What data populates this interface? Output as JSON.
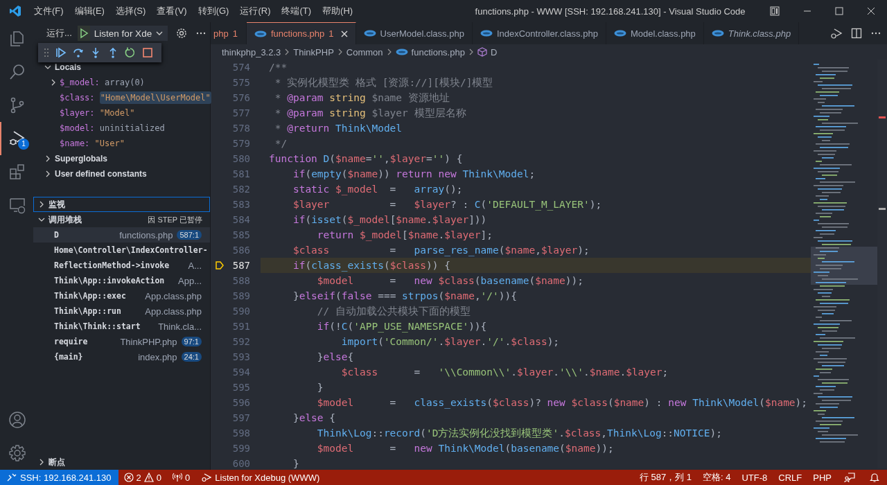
{
  "title_bar": {
    "menus": [
      "文件(F)",
      "编辑(E)",
      "选择(S)",
      "查看(V)",
      "转到(G)",
      "运行(R)",
      "终端(T)",
      "帮助(H)"
    ],
    "title": "functions.php - WWW [SSH: 192.168.241.130] - Visual Studio Code"
  },
  "activity_bar": {
    "items": [
      {
        "kind": "explorer",
        "selected": false
      },
      {
        "kind": "search",
        "selected": false
      },
      {
        "kind": "scm",
        "selected": false
      },
      {
        "kind": "debug",
        "selected": true,
        "badge": "1"
      },
      {
        "kind": "extensions",
        "selected": false
      },
      {
        "kind": "remote",
        "selected": false
      }
    ],
    "bottom": [
      {
        "kind": "account"
      },
      {
        "kind": "settings"
      }
    ]
  },
  "run_view": {
    "title": "运行...",
    "config": "Listen for Xde",
    "debug_toolbar": [
      {
        "kind": "continue"
      },
      {
        "kind": "step_over"
      },
      {
        "kind": "step_into"
      },
      {
        "kind": "step_out"
      },
      {
        "kind": "restart"
      },
      {
        "kind": "stop"
      }
    ],
    "locals": {
      "label": "Locals",
      "expanded": true,
      "variables": [
        {
          "name": "$_model:",
          "value": "array(0)",
          "kind": "other",
          "expandable": true,
          "selected": false
        },
        {
          "name": "$class:",
          "value": "\"Home\\Model\\UserModel\"",
          "kind": "string",
          "expandable": false,
          "selected": true
        },
        {
          "name": "$layer:",
          "value": "\"Model\"",
          "kind": "string",
          "expandable": false,
          "selected": false
        },
        {
          "name": "$model:",
          "value": "uninitialized",
          "kind": "other",
          "expandable": false,
          "selected": false
        },
        {
          "name": "$name:",
          "value": "\"User\"",
          "kind": "string",
          "expandable": false,
          "selected": false
        }
      ]
    },
    "groups": [
      {
        "label": "Superglobals",
        "expanded": false
      },
      {
        "label": "User defined constants",
        "expanded": false
      }
    ],
    "watch": {
      "label": "监视",
      "expanded": false,
      "focused": true
    },
    "call_stack": {
      "label": "调用堆栈",
      "expanded": true,
      "status": "因 STEP 已暂停",
      "frames": [
        {
          "name": "D",
          "file": "functions.php",
          "line": "587:1",
          "selected": true
        },
        {
          "name": "Home\\Controller\\IndexController-",
          "selected": false
        },
        {
          "name": "ReflectionMethod->invoke",
          "file": "A...",
          "selected": false
        },
        {
          "name": "Think\\App::invokeAction",
          "file": "App...",
          "selected": false
        },
        {
          "name": "Think\\App::exec",
          "file": "App.class.php",
          "selected": false
        },
        {
          "name": "Think\\App::run",
          "file": "App.class.php",
          "selected": false
        },
        {
          "name": "Think\\Think::start",
          "file": "Think.cla...",
          "selected": false
        },
        {
          "name": "require",
          "file": "ThinkPHP.php",
          "line": "97:1",
          "selected": false
        },
        {
          "name": "{main}",
          "file": "index.php",
          "line": "24:1",
          "selected": false
        }
      ]
    },
    "breakpoints": {
      "label": "断点",
      "expanded": false
    }
  },
  "tabs": [
    {
      "label": "php",
      "problems": "1",
      "selected": false,
      "cut": true,
      "preview": false
    },
    {
      "label": "functions.php",
      "problems": "1",
      "selected": true,
      "cut": false,
      "preview": false
    },
    {
      "label": "UserModel.class.php",
      "selected": false,
      "cut": false,
      "preview": false
    },
    {
      "label": "IndexController.class.php",
      "selected": false,
      "cut": false,
      "preview": false
    },
    {
      "label": "Model.class.php",
      "selected": false,
      "cut": false,
      "preview": false
    },
    {
      "label": "Think.class.php",
      "selected": false,
      "cut": false,
      "preview": true
    }
  ],
  "breadcrumb": [
    {
      "label": "thinkphp_3.2.3",
      "kind": "folder"
    },
    {
      "label": "ThinkPHP",
      "kind": "folder"
    },
    {
      "label": "Common",
      "kind": "folder"
    },
    {
      "label": "functions.php",
      "kind": "file"
    },
    {
      "label": "D",
      "kind": "symbol"
    }
  ],
  "editor": {
    "lines": [
      {
        "n": "574",
        "paused": false,
        "tokens": [
          {
            "kind": "comment",
            "text": "/**"
          }
        ]
      },
      {
        "n": "575",
        "paused": false,
        "tokens": [
          {
            "kind": "comment",
            "text": " * 实例化模型类 格式 [资源://][模块/]模型"
          }
        ]
      },
      {
        "n": "576",
        "paused": false,
        "tokens": [
          {
            "kind": "comment",
            "text": " * "
          },
          {
            "kind": "doctag",
            "text": "@param"
          },
          {
            "kind": "doctype",
            "text": " string"
          },
          {
            "kind": "comment",
            "text": " $name 资源地址"
          }
        ]
      },
      {
        "n": "577",
        "paused": false,
        "tokens": [
          {
            "kind": "comment",
            "text": " * "
          },
          {
            "kind": "doctag",
            "text": "@param"
          },
          {
            "kind": "doctype",
            "text": " string"
          },
          {
            "kind": "comment",
            "text": " $layer 模型层名称"
          }
        ]
      },
      {
        "n": "578",
        "paused": false,
        "tokens": [
          {
            "kind": "comment",
            "text": " * "
          },
          {
            "kind": "doctag",
            "text": "@return"
          },
          {
            "kind": "type",
            "text": " Think\\Model"
          }
        ]
      },
      {
        "n": "579",
        "paused": false,
        "tokens": [
          {
            "kind": "comment",
            "text": " */"
          }
        ]
      },
      {
        "n": "580",
        "paused": false,
        "tokens": [
          {
            "kind": "keyword",
            "text": "function"
          },
          {
            "kind": "function",
            "text": " D"
          },
          {
            "kind": "plain",
            "text": "("
          },
          {
            "kind": "variable",
            "text": "$name"
          },
          {
            "kind": "plain",
            "text": "="
          },
          {
            "kind": "string",
            "text": "''"
          },
          {
            "kind": "plain",
            "text": ","
          },
          {
            "kind": "variable",
            "text": "$layer"
          },
          {
            "kind": "plain",
            "text": "="
          },
          {
            "kind": "string",
            "text": "''"
          },
          {
            "kind": "plain",
            "text": ") {"
          }
        ]
      },
      {
        "n": "581",
        "paused": false,
        "tokens": [
          {
            "kind": "keyword",
            "text": "    if"
          },
          {
            "kind": "plain",
            "text": "("
          },
          {
            "kind": "function",
            "text": "empty"
          },
          {
            "kind": "plain",
            "text": "("
          },
          {
            "kind": "variable",
            "text": "$name"
          },
          {
            "kind": "plain",
            "text": "))"
          },
          {
            "kind": "keyword",
            "text": " return new"
          },
          {
            "kind": "type",
            "text": " Think\\Model"
          },
          {
            "kind": "plain",
            "text": ";"
          }
        ]
      },
      {
        "n": "582",
        "paused": false,
        "tokens": [
          {
            "kind": "keyword",
            "text": "    static"
          },
          {
            "kind": "variable",
            "text": " $_model"
          },
          {
            "kind": "plain",
            "text": "  =   "
          },
          {
            "kind": "function",
            "text": "array"
          },
          {
            "kind": "plain",
            "text": "();"
          }
        ]
      },
      {
        "n": "583",
        "paused": false,
        "tokens": [
          {
            "kind": "variable",
            "text": "    $layer"
          },
          {
            "kind": "plain",
            "text": "          =   "
          },
          {
            "kind": "variable",
            "text": "$layer"
          },
          {
            "kind": "plain",
            "text": "? : "
          },
          {
            "kind": "function",
            "text": "C"
          },
          {
            "kind": "plain",
            "text": "("
          },
          {
            "kind": "string",
            "text": "'DEFAULT_M_LAYER'"
          },
          {
            "kind": "plain",
            "text": ");"
          }
        ]
      },
      {
        "n": "584",
        "paused": false,
        "tokens": [
          {
            "kind": "keyword",
            "text": "    if"
          },
          {
            "kind": "plain",
            "text": "("
          },
          {
            "kind": "function",
            "text": "isset"
          },
          {
            "kind": "plain",
            "text": "("
          },
          {
            "kind": "variable",
            "text": "$_model"
          },
          {
            "kind": "plain",
            "text": "["
          },
          {
            "kind": "variable",
            "text": "$name"
          },
          {
            "kind": "plain",
            "text": "."
          },
          {
            "kind": "variable",
            "text": "$layer"
          },
          {
            "kind": "plain",
            "text": "]))"
          }
        ]
      },
      {
        "n": "585",
        "paused": false,
        "tokens": [
          {
            "kind": "keyword",
            "text": "        return"
          },
          {
            "kind": "variable",
            "text": " $_model"
          },
          {
            "kind": "plain",
            "text": "["
          },
          {
            "kind": "variable",
            "text": "$name"
          },
          {
            "kind": "plain",
            "text": "."
          },
          {
            "kind": "variable",
            "text": "$layer"
          },
          {
            "kind": "plain",
            "text": "];"
          }
        ]
      },
      {
        "n": "586",
        "paused": false,
        "tokens": [
          {
            "kind": "variable",
            "text": "    $class"
          },
          {
            "kind": "plain",
            "text": "          =   "
          },
          {
            "kind": "function",
            "text": "parse_res_name"
          },
          {
            "kind": "plain",
            "text": "("
          },
          {
            "kind": "variable",
            "text": "$name"
          },
          {
            "kind": "plain",
            "text": ","
          },
          {
            "kind": "variable",
            "text": "$layer"
          },
          {
            "kind": "plain",
            "text": ");"
          }
        ]
      },
      {
        "n": "587",
        "paused": true,
        "tokens": [
          {
            "kind": "keyword",
            "text": "    if"
          },
          {
            "kind": "plain",
            "text": "("
          },
          {
            "kind": "function",
            "text": "class_exists"
          },
          {
            "kind": "plain",
            "text": "("
          },
          {
            "kind": "variable",
            "text": "$class"
          },
          {
            "kind": "plain",
            "text": ")) {"
          }
        ]
      },
      {
        "n": "588",
        "paused": false,
        "tokens": [
          {
            "kind": "variable",
            "text": "        $model"
          },
          {
            "kind": "plain",
            "text": "      =   "
          },
          {
            "kind": "keyword",
            "text": "new"
          },
          {
            "kind": "variable",
            "text": " $class"
          },
          {
            "kind": "plain",
            "text": "("
          },
          {
            "kind": "function",
            "text": "basename"
          },
          {
            "kind": "plain",
            "text": "("
          },
          {
            "kind": "variable",
            "text": "$name"
          },
          {
            "kind": "plain",
            "text": "));"
          }
        ]
      },
      {
        "n": "589",
        "paused": false,
        "tokens": [
          {
            "kind": "plain",
            "text": "    }"
          },
          {
            "kind": "keyword",
            "text": "elseif"
          },
          {
            "kind": "plain",
            "text": "("
          },
          {
            "kind": "keyword",
            "text": "false"
          },
          {
            "kind": "plain",
            "text": " === "
          },
          {
            "kind": "function",
            "text": "strpos"
          },
          {
            "kind": "plain",
            "text": "("
          },
          {
            "kind": "variable",
            "text": "$name"
          },
          {
            "kind": "plain",
            "text": ","
          },
          {
            "kind": "string",
            "text": "'/'"
          },
          {
            "kind": "plain",
            "text": ")){"
          }
        ]
      },
      {
        "n": "590",
        "paused": false,
        "tokens": [
          {
            "kind": "comment",
            "text": "        // 自动加载公共模块下面的模型"
          }
        ]
      },
      {
        "n": "591",
        "paused": false,
        "tokens": [
          {
            "kind": "keyword",
            "text": "        if"
          },
          {
            "kind": "plain",
            "text": "(!"
          },
          {
            "kind": "function",
            "text": "C"
          },
          {
            "kind": "plain",
            "text": "("
          },
          {
            "kind": "string",
            "text": "'APP_USE_NAMESPACE'"
          },
          {
            "kind": "plain",
            "text": ")){"
          }
        ]
      },
      {
        "n": "592",
        "paused": false,
        "tokens": [
          {
            "kind": "function",
            "text": "            import"
          },
          {
            "kind": "plain",
            "text": "("
          },
          {
            "kind": "string",
            "text": "'Common/'"
          },
          {
            "kind": "plain",
            "text": "."
          },
          {
            "kind": "variable",
            "text": "$layer"
          },
          {
            "kind": "plain",
            "text": "."
          },
          {
            "kind": "string",
            "text": "'/'"
          },
          {
            "kind": "plain",
            "text": "."
          },
          {
            "kind": "variable",
            "text": "$class"
          },
          {
            "kind": "plain",
            "text": ");"
          }
        ]
      },
      {
        "n": "593",
        "paused": false,
        "tokens": [
          {
            "kind": "plain",
            "text": "        }"
          },
          {
            "kind": "keyword",
            "text": "else"
          },
          {
            "kind": "plain",
            "text": "{"
          }
        ]
      },
      {
        "n": "594",
        "paused": false,
        "tokens": [
          {
            "kind": "variable",
            "text": "            $class"
          },
          {
            "kind": "plain",
            "text": "      =   "
          },
          {
            "kind": "string",
            "text": "'\\\\Common\\\\'"
          },
          {
            "kind": "plain",
            "text": "."
          },
          {
            "kind": "variable",
            "text": "$layer"
          },
          {
            "kind": "plain",
            "text": "."
          },
          {
            "kind": "string",
            "text": "'\\\\'"
          },
          {
            "kind": "plain",
            "text": "."
          },
          {
            "kind": "variable",
            "text": "$name"
          },
          {
            "kind": "plain",
            "text": "."
          },
          {
            "kind": "variable",
            "text": "$layer"
          },
          {
            "kind": "plain",
            "text": ";"
          }
        ]
      },
      {
        "n": "595",
        "paused": false,
        "tokens": [
          {
            "kind": "plain",
            "text": "        }"
          }
        ]
      },
      {
        "n": "596",
        "paused": false,
        "tokens": [
          {
            "kind": "variable",
            "text": "        $model"
          },
          {
            "kind": "plain",
            "text": "      =   "
          },
          {
            "kind": "function",
            "text": "class_exists"
          },
          {
            "kind": "plain",
            "text": "("
          },
          {
            "kind": "variable",
            "text": "$class"
          },
          {
            "kind": "plain",
            "text": ")?"
          },
          {
            "kind": "keyword",
            "text": " new"
          },
          {
            "kind": "variable",
            "text": " $class"
          },
          {
            "kind": "plain",
            "text": "("
          },
          {
            "kind": "variable",
            "text": "$name"
          },
          {
            "kind": "plain",
            "text": ") :"
          },
          {
            "kind": "keyword",
            "text": " new"
          },
          {
            "kind": "type",
            "text": " Think\\Model"
          },
          {
            "kind": "plain",
            "text": "("
          },
          {
            "kind": "variable",
            "text": "$name"
          },
          {
            "kind": "plain",
            "text": ");"
          }
        ]
      },
      {
        "n": "597",
        "paused": false,
        "tokens": [
          {
            "kind": "plain",
            "text": "    }"
          },
          {
            "kind": "keyword",
            "text": "else"
          },
          {
            "kind": "plain",
            "text": " {"
          }
        ]
      },
      {
        "n": "598",
        "paused": false,
        "tokens": [
          {
            "kind": "type",
            "text": "        Think\\Log"
          },
          {
            "kind": "plain",
            "text": "::"
          },
          {
            "kind": "function",
            "text": "record"
          },
          {
            "kind": "plain",
            "text": "("
          },
          {
            "kind": "string",
            "text": "'D方法实例化没找到模型类'"
          },
          {
            "kind": "plain",
            "text": "."
          },
          {
            "kind": "variable",
            "text": "$class"
          },
          {
            "kind": "plain",
            "text": ","
          },
          {
            "kind": "type",
            "text": "Think\\Log"
          },
          {
            "kind": "plain",
            "text": "::"
          },
          {
            "kind": "type",
            "text": "NOTICE"
          },
          {
            "kind": "plain",
            "text": ");"
          }
        ]
      },
      {
        "n": "599",
        "paused": false,
        "tokens": [
          {
            "kind": "variable",
            "text": "        $model"
          },
          {
            "kind": "plain",
            "text": "      =   "
          },
          {
            "kind": "keyword",
            "text": "new"
          },
          {
            "kind": "type",
            "text": " Think\\Model"
          },
          {
            "kind": "plain",
            "text": "("
          },
          {
            "kind": "function",
            "text": "basename"
          },
          {
            "kind": "plain",
            "text": "("
          },
          {
            "kind": "variable",
            "text": "$name"
          },
          {
            "kind": "plain",
            "text": "));"
          }
        ]
      },
      {
        "n": "600",
        "paused": false,
        "tokens": [
          {
            "kind": "plain",
            "text": "    }"
          }
        ]
      }
    ]
  },
  "status_bar": {
    "remote": "SSH: 192.168.241.130",
    "errors": "2",
    "warnings": "0",
    "ports": "0",
    "debug": "Listen for Xdebug (WWW)",
    "right": [
      "行 587，列 1",
      "空格: 4",
      "UTF-8",
      "CRLF",
      "PHP"
    ]
  }
}
